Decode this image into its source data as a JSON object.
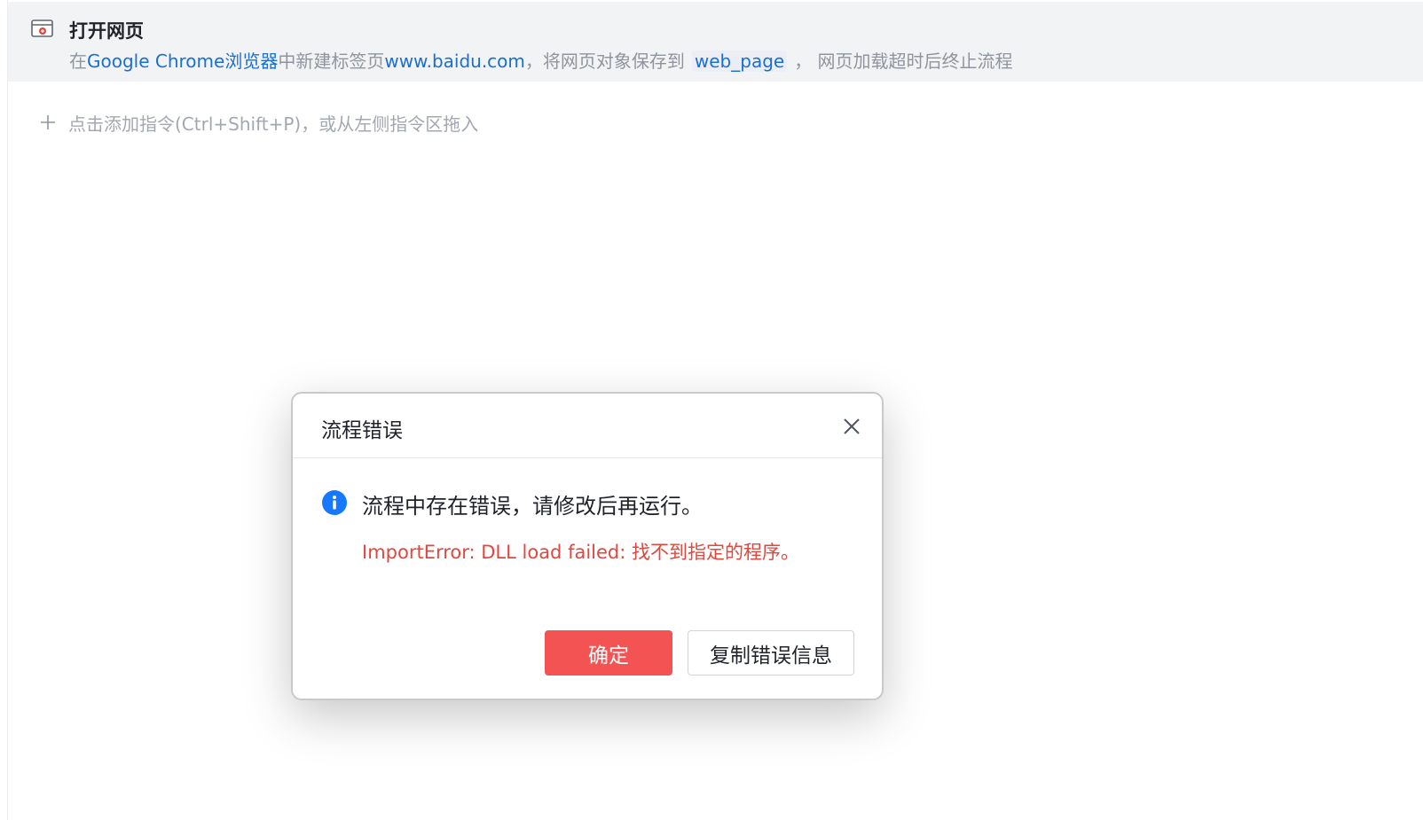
{
  "command": {
    "title": "打开网页",
    "description": {
      "prefix": "在",
      "browser": "Google Chrome浏览器",
      "mid": "中新建标签页",
      "url": "www.baidu.com",
      "save_text": "，将网页对象保存到",
      "variable": "web_page",
      "suffix": "， 网页加载超时后终止流程"
    },
    "icon": "browser-window-icon"
  },
  "add_command": {
    "label": "点击添加指令(Ctrl+Shift+P)，或从左侧指令区拖入",
    "icon": "plus-icon"
  },
  "dialog": {
    "title": "流程错误",
    "message": "流程中存在错误，请修改后再运行。",
    "error": "ImportError: DLL load failed: 找不到指定的程序。",
    "confirm_label": "确定",
    "copy_label": "复制错误信息",
    "icon": "info-icon",
    "close_icon": "close-icon"
  },
  "colors": {
    "accent_blue": "#1a6fd3",
    "error_red": "#e0473e",
    "confirm_button": "#f45353",
    "info_blue": "#1677ff"
  }
}
